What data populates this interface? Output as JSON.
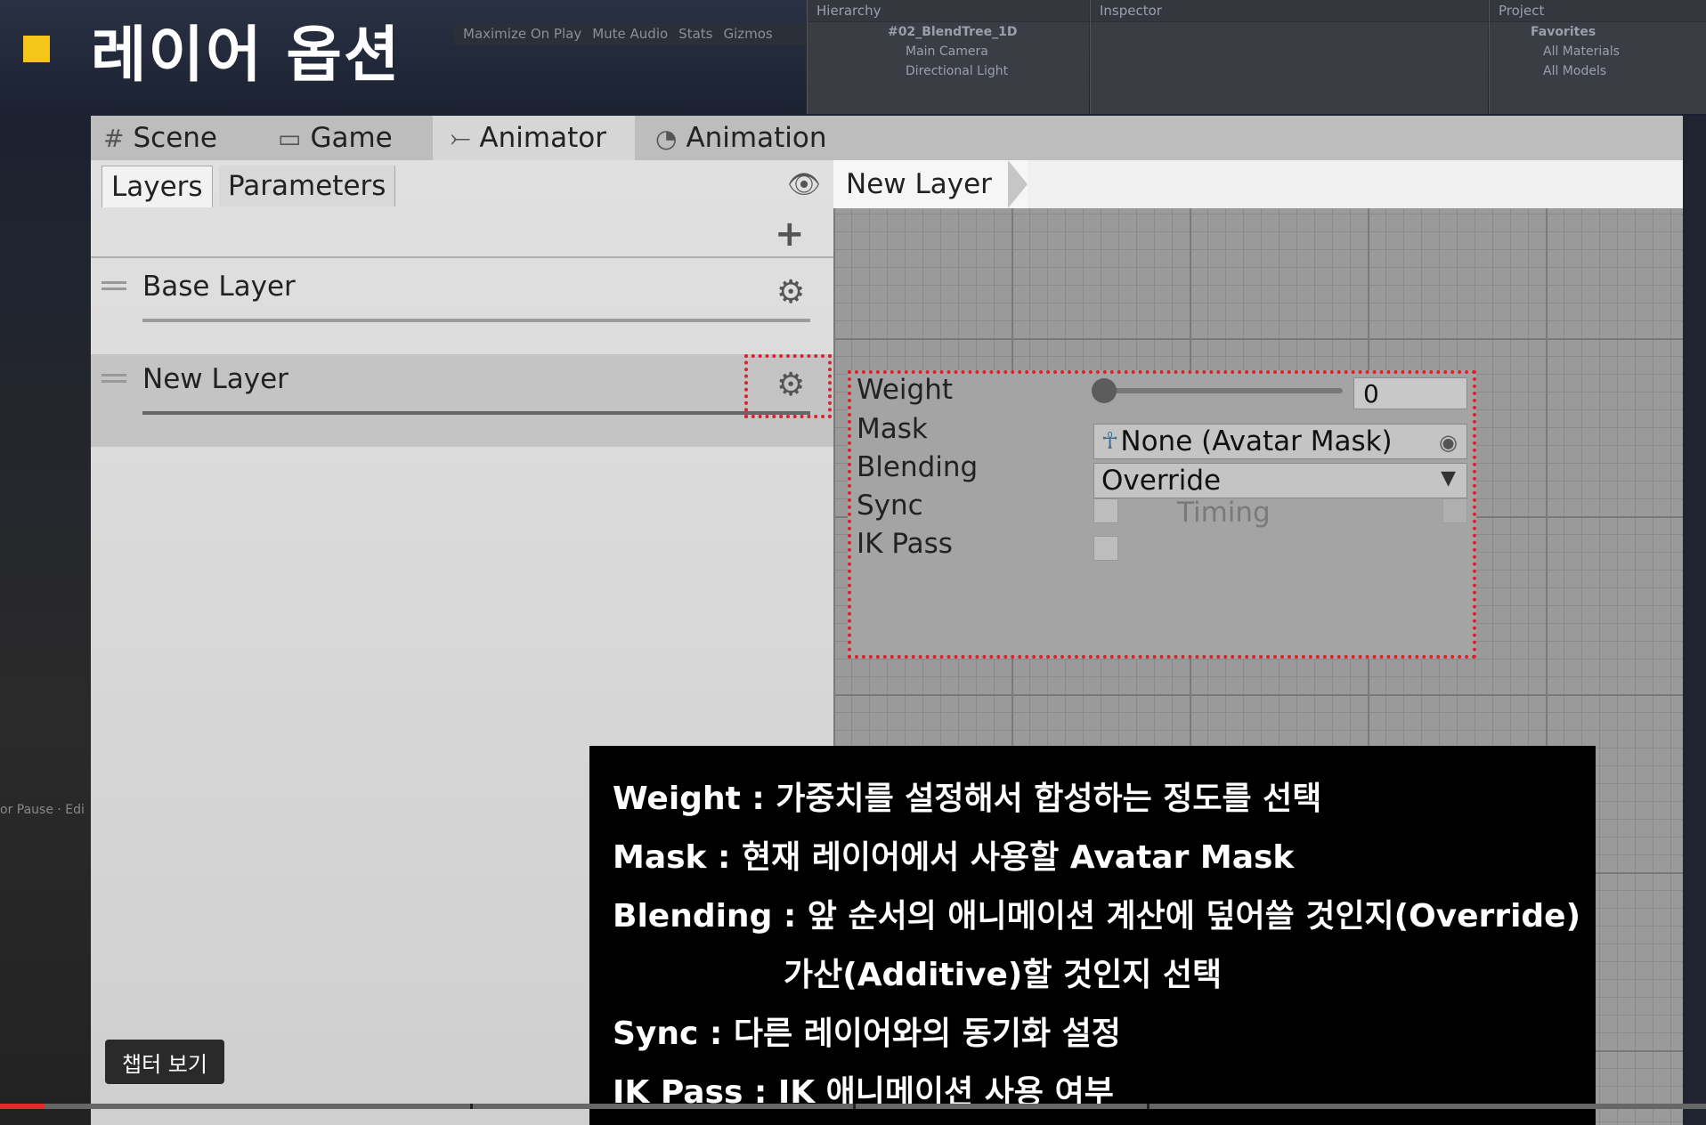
{
  "video_title": "레이어 옵션",
  "unity_background": {
    "toolbar_items": [
      "Maximize On Play",
      "Mute Audio",
      "Stats",
      "Gizmos"
    ],
    "hierarchy": {
      "title": "Hierarchy",
      "items": [
        "#02_BlendTree_1D",
        "Main Camera",
        "Directional Light"
      ]
    },
    "inspector": {
      "title": "Inspector"
    },
    "project": {
      "title": "Project",
      "items": [
        "Favorites",
        "All Materials",
        "All Models"
      ]
    },
    "pause_text": "or Pause · Edi"
  },
  "tabs": [
    {
      "label": "Scene",
      "icon": "grid-icon"
    },
    {
      "label": "Game",
      "icon": "gamepad-icon"
    },
    {
      "label": "Animator",
      "icon": "animator-icon",
      "active": true
    },
    {
      "label": "Animation",
      "icon": "clock-icon"
    }
  ],
  "subtabs": {
    "layers": "Layers",
    "parameters": "Parameters"
  },
  "layers": [
    {
      "name": "Base Layer"
    },
    {
      "name": "New Layer",
      "selected": true
    }
  ],
  "breadcrumb": "New Layer",
  "layer_settings": {
    "weight_label": "Weight",
    "weight_value": "0",
    "mask_label": "Mask",
    "mask_value": "None (Avatar Mask)",
    "blending_label": "Blending",
    "blending_value": "Override",
    "sync_label": "Sync",
    "timing_label": "Timing",
    "ik_pass_label": "IK Pass"
  },
  "captions": [
    "Weight : 가중치를 설정해서 합성하는 정도를 선택",
    "Mask : 현재 레이어에서 사용할 Avatar Mask",
    "Blending : 앞 순서의 애니메이션 계산에 덮어쓸 것인지(Override)",
    "가산(Additive)할 것인지 선택",
    "Sync : 다른 레이어와의 동기화 설정",
    "IK Pass : IK 애니메이션 사용 여부"
  ],
  "chapter_button": "챕터 보기",
  "video_progress": 0.026,
  "colors": {
    "accent_square": "#f5c518",
    "highlight_border": "#d9232f",
    "progress": "#e8262b"
  }
}
